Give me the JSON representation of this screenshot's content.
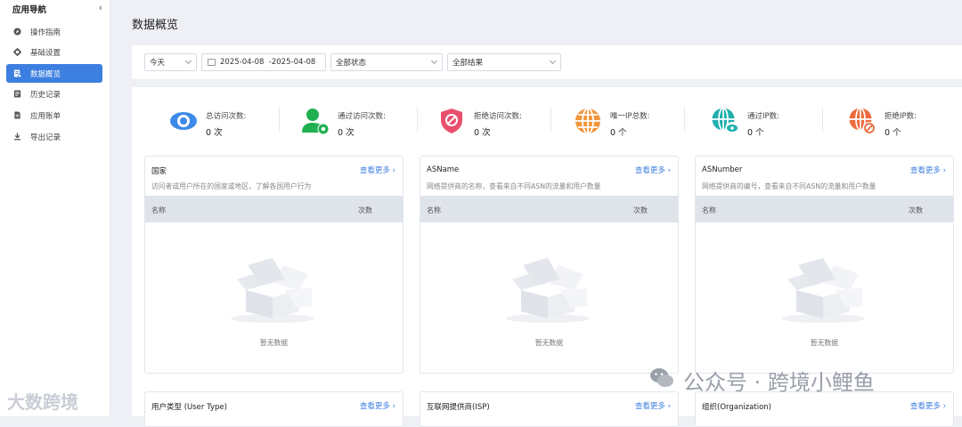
{
  "sidebar": {
    "title": "应用导航",
    "items": [
      {
        "label": "操作指南",
        "icon": "compass-icon"
      },
      {
        "label": "基础设置",
        "icon": "gear-icon"
      },
      {
        "label": "数据概览",
        "icon": "data-overview-icon",
        "active": true
      },
      {
        "label": "历史记录",
        "icon": "history-icon"
      },
      {
        "label": "应用账单",
        "icon": "bill-icon"
      },
      {
        "label": "导出记录",
        "icon": "download-icon"
      }
    ]
  },
  "page": {
    "title": "数据概览"
  },
  "filters": {
    "time": "今天",
    "date_range": "2025-04-08  -2025-04-08",
    "status": "全部状态",
    "result": "全部结果"
  },
  "stats": [
    {
      "label": "总访问次数:",
      "value": "0 次",
      "icon": "eye-icon",
      "color": "#3d8be8"
    },
    {
      "label": "通过访问次数:",
      "value": "0 次",
      "icon": "user-check-icon",
      "color": "#1fb04f"
    },
    {
      "label": "拒绝访问次数:",
      "value": "0 次",
      "icon": "shield-block-icon",
      "color": "#e8506e"
    },
    {
      "label": "唯一IP总数:",
      "value": "0 个",
      "icon": "globe-icon",
      "color": "#f0963a"
    },
    {
      "label": "通过IP数:",
      "value": "0 个",
      "icon": "globe-eye-icon",
      "color": "#1fb0b0"
    },
    {
      "label": "拒绝IP数:",
      "value": "0 个",
      "icon": "globe-block-icon",
      "color": "#ee6a3c"
    }
  ],
  "cards": [
    {
      "title": "国家",
      "more": "查看更多",
      "desc": "访问者或用户所在的国家或地区，了解各国用户行为",
      "col1": "名称",
      "col2": "次数",
      "empty": "暂无数据"
    },
    {
      "title": "ASName",
      "more": "查看更多",
      "desc": "网络提供商的名称，查看来自不同ASN的流量和用户数量",
      "col1": "名称",
      "col2": "次数",
      "empty": "暂无数据"
    },
    {
      "title": "ASNumber",
      "more": "查看更多",
      "desc": "网络提供商的编号，查看来自不同ASN的流量和用户数量",
      "col1": "名称",
      "col2": "次数",
      "empty": "暂无数据"
    }
  ],
  "cards_row2": [
    {
      "title": "用户类型 (User Type)",
      "more": "查看更多"
    },
    {
      "title": "互联网提供商(ISP)",
      "more": "查看更多"
    },
    {
      "title": "组织(Organization)",
      "more": "查看更多"
    }
  ],
  "watermarks": {
    "left": "大数跨境",
    "right": "公众号 · 跨境小鲤鱼"
  }
}
